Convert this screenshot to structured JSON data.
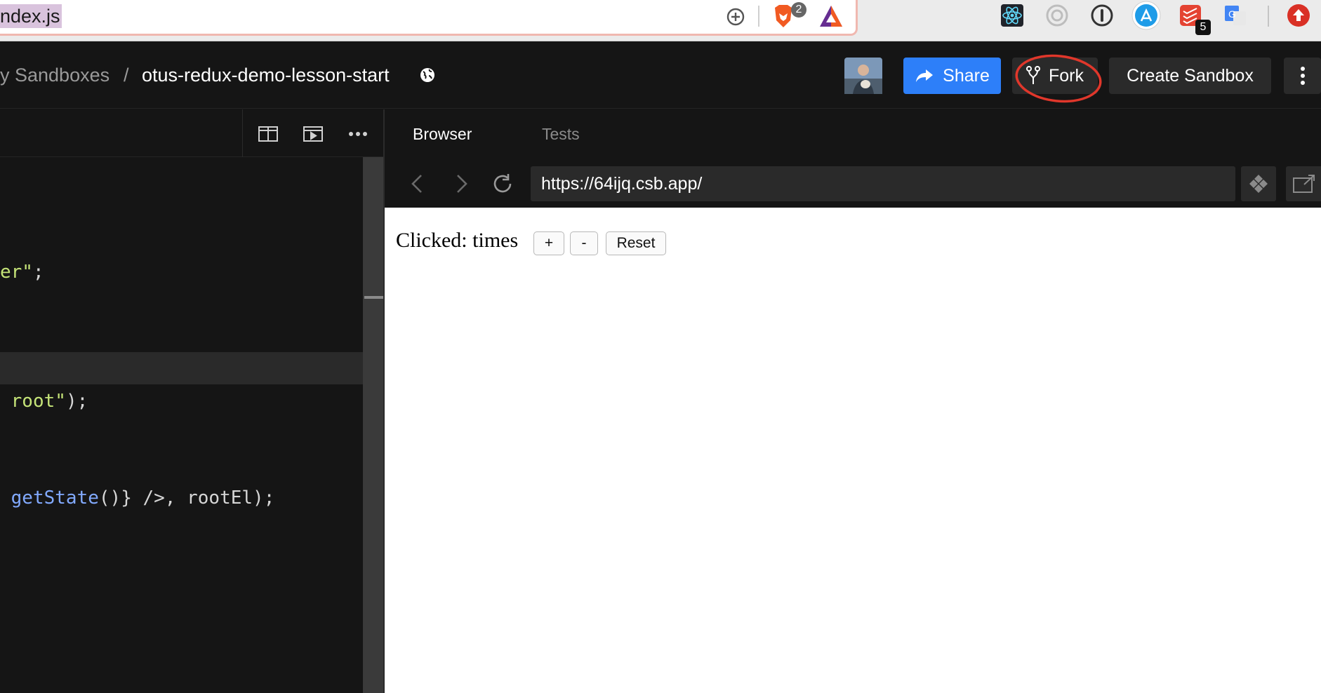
{
  "browser": {
    "address_text": "ndex.js",
    "extensions": {
      "brave_badge": "2",
      "todoist_badge": "5"
    }
  },
  "header": {
    "breadcrumb_parent": "y Sandboxes",
    "breadcrumb_separator": "/",
    "sandbox_name": "otus-redux-demo-lesson-start",
    "share_label": "Share",
    "fork_label": "Fork",
    "create_label": "Create Sandbox"
  },
  "editor": {
    "lines": [
      {
        "plain": "",
        "str": "er\"",
        "tail": ";"
      },
      {
        "plain": " ",
        "str": "root\"",
        "tail": ");"
      },
      {
        "plain": " ",
        "fn": "getState",
        "tail": "()} />, rootEl);"
      }
    ]
  },
  "preview": {
    "tabs": {
      "browser": "Browser",
      "tests": "Tests"
    },
    "url": "https://64ijq.csb.app/",
    "app": {
      "clicked_text": "Clicked: times",
      "plus_label": "+",
      "minus_label": "-",
      "reset_label": "Reset"
    }
  },
  "colors": {
    "accent_blue": "#2d7ff9",
    "annotation_red": "#e0372b",
    "code_string": "#c5e478",
    "code_function": "#82aaff"
  }
}
